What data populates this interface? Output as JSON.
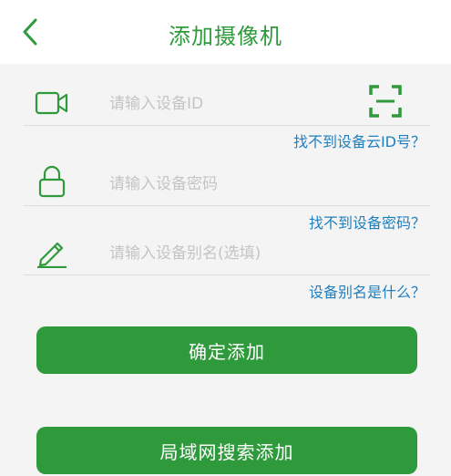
{
  "header": {
    "title": "添加摄像机",
    "back_icon": "chevron-left-icon"
  },
  "colors": {
    "accent": "#2e9a3c",
    "link": "#1f7fbf",
    "placeholder": "#c4c4c4",
    "background": "#f4f4f4"
  },
  "form": {
    "device_id": {
      "icon": "video-camera-icon",
      "value": "",
      "placeholder": "请输入设备ID",
      "scan_icon": "qr-scan-icon",
      "help": "找不到设备云ID号？"
    },
    "password": {
      "icon": "lock-icon",
      "value": "",
      "placeholder": "请输入设备密码",
      "help": "找不到设备密码？"
    },
    "alias": {
      "icon": "pencil-icon",
      "value": "",
      "placeholder": "请输入设备别名(选填)",
      "help": "设备别名是什么？"
    }
  },
  "actions": {
    "confirm_label": "确定添加",
    "lan_search_label": "局域网搜索添加"
  }
}
